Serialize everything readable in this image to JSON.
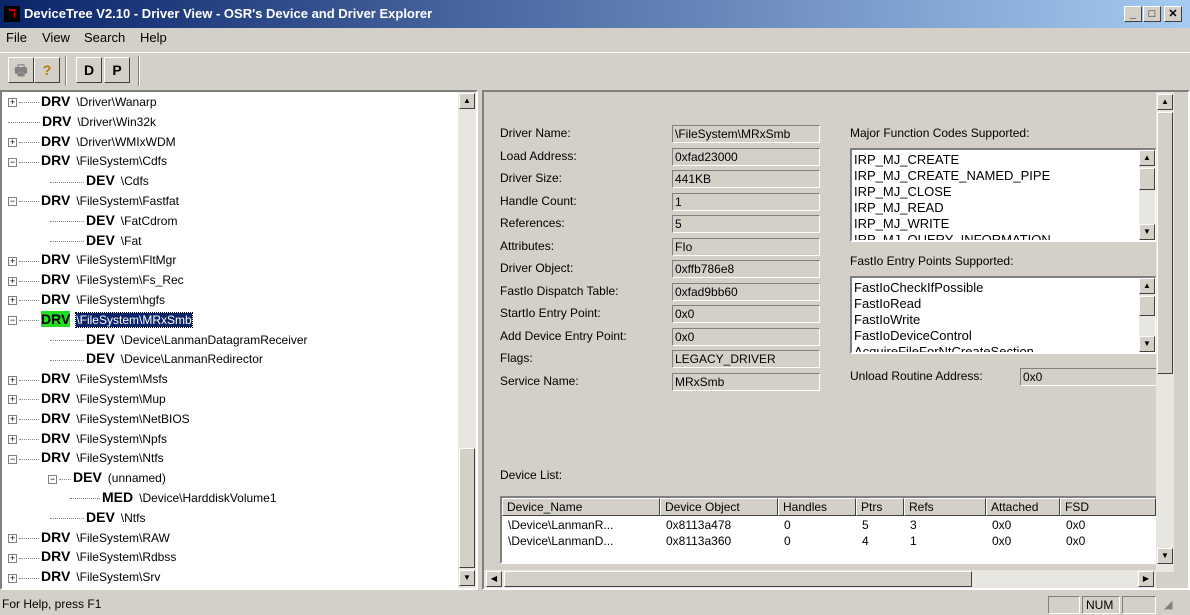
{
  "window": {
    "title": "DeviceTree V2.10 - Driver View - OSR's Device and Driver Explorer",
    "controls": {
      "minimize": "_",
      "maximize": "□",
      "close": "✕"
    }
  },
  "menu": [
    "File",
    "View",
    "Search",
    "Help"
  ],
  "toolbar": {
    "print_icon": "🖶",
    "help_icon": "?",
    "d_label": "D",
    "p_label": "P"
  },
  "tree": {
    "rows": [
      {
        "kind": "DRV",
        "path": "\\Driver\\Wanarp",
        "exp": "+",
        "level": 0
      },
      {
        "kind": "DRV",
        "path": "\\Driver\\Win32k",
        "exp": "",
        "level": 0
      },
      {
        "kind": "DRV",
        "path": "\\Driver\\WMIxWDM",
        "exp": "+",
        "level": 0
      },
      {
        "kind": "DRV",
        "path": "\\FileSystem\\Cdfs",
        "exp": "−",
        "level": 0
      },
      {
        "kind": "DEV",
        "path": "\\Cdfs",
        "exp": "",
        "level": 1
      },
      {
        "kind": "DRV",
        "path": "\\FileSystem\\Fastfat",
        "exp": "−",
        "level": 0
      },
      {
        "kind": "DEV",
        "path": "\\FatCdrom",
        "exp": "",
        "level": 1
      },
      {
        "kind": "DEV",
        "path": "\\Fat",
        "exp": "",
        "level": 1
      },
      {
        "kind": "DRV",
        "path": "\\FileSystem\\FltMgr",
        "exp": "+",
        "level": 0
      },
      {
        "kind": "DRV",
        "path": "\\FileSystem\\Fs_Rec",
        "exp": "+",
        "level": 0
      },
      {
        "kind": "DRV",
        "path": "\\FileSystem\\hgfs",
        "exp": "+",
        "level": 0
      },
      {
        "kind": "DRV",
        "path": "\\FileSystem\\MRxSmb",
        "exp": "−",
        "level": 0,
        "selected": true
      },
      {
        "kind": "DEV",
        "path": "\\Device\\LanmanDatagramReceiver",
        "exp": "",
        "level": 1
      },
      {
        "kind": "DEV",
        "path": "\\Device\\LanmanRedirector",
        "exp": "",
        "level": 1
      },
      {
        "kind": "DRV",
        "path": "\\FileSystem\\Msfs",
        "exp": "+",
        "level": 0
      },
      {
        "kind": "DRV",
        "path": "\\FileSystem\\Mup",
        "exp": "+",
        "level": 0
      },
      {
        "kind": "DRV",
        "path": "\\FileSystem\\NetBIOS",
        "exp": "+",
        "level": 0
      },
      {
        "kind": "DRV",
        "path": "\\FileSystem\\Npfs",
        "exp": "+",
        "level": 0
      },
      {
        "kind": "DRV",
        "path": "\\FileSystem\\Ntfs",
        "exp": "−",
        "level": 0
      },
      {
        "kind": "DEV",
        "path": "(unnamed)",
        "exp": "−",
        "level": 2
      },
      {
        "kind": "MED",
        "path": "\\Device\\HarddiskVolume1",
        "exp": "",
        "level": 3
      },
      {
        "kind": "DEV",
        "path": "\\Ntfs",
        "exp": "",
        "level": 1
      },
      {
        "kind": "DRV",
        "path": "\\FileSystem\\RAW",
        "exp": "+",
        "level": 0
      },
      {
        "kind": "DRV",
        "path": "\\FileSystem\\Rdbss",
        "exp": "+",
        "level": 0
      },
      {
        "kind": "DRV",
        "path": "\\FileSystem\\Srv",
        "exp": "+",
        "level": 0
      }
    ]
  },
  "details": {
    "fields": [
      {
        "label": "Driver Name:",
        "value": "\\FileSystem\\MRxSmb"
      },
      {
        "label": "Load Address:",
        "value": "0xfad23000"
      },
      {
        "label": "Driver Size:",
        "value": "441KB"
      },
      {
        "label": "Handle Count:",
        "value": "1"
      },
      {
        "label": "References:",
        "value": "5"
      },
      {
        "label": "Attributes:",
        "value": "FIo"
      },
      {
        "label": "Driver Object:",
        "value": "0xffb786e8"
      },
      {
        "label": "FastIo Dispatch Table:",
        "value": "0xfad9bb60"
      },
      {
        "label": "StartIo Entry Point:",
        "value": "0x0"
      },
      {
        "label": "Add Device Entry Point:",
        "value": "0x0"
      },
      {
        "label": "Flags:",
        "value": "LEGACY_DRIVER"
      },
      {
        "label": "Service Name:",
        "value": "MRxSmb"
      }
    ],
    "major_label": "Major Function Codes Supported:",
    "major_codes": [
      "IRP_MJ_CREATE",
      "IRP_MJ_CREATE_NAMED_PIPE",
      "IRP_MJ_CLOSE",
      "IRP_MJ_READ",
      "IRP_MJ_WRITE",
      "IRP_MJ_QUERY_INFORMATION"
    ],
    "fastio_label": "FastIo Entry Points Supported:",
    "fastio_points": [
      "FastIoCheckIfPossible",
      "FastIoRead",
      "FastIoWrite",
      "FastIoDeviceControl",
      "AcquireFileForNtCreateSection"
    ],
    "unload_label": "Unload Routine Address:",
    "unload_value": "0x0"
  },
  "device_list": {
    "label": "Device List:",
    "columns": [
      "Device_Name",
      "Device Object",
      "Handles",
      "Ptrs",
      "Refs",
      "Attached",
      "FSD"
    ],
    "rows": [
      [
        "\\Device\\LanmanR...",
        "0x8113a478",
        "0",
        "5",
        "3",
        "0x0",
        "0x0"
      ],
      [
        "\\Device\\LanmanD...",
        "0x8113a360",
        "0",
        "4",
        "1",
        "0x0",
        "0x0"
      ]
    ]
  },
  "status": {
    "text": "For Help, press F1",
    "num": "NUM"
  }
}
